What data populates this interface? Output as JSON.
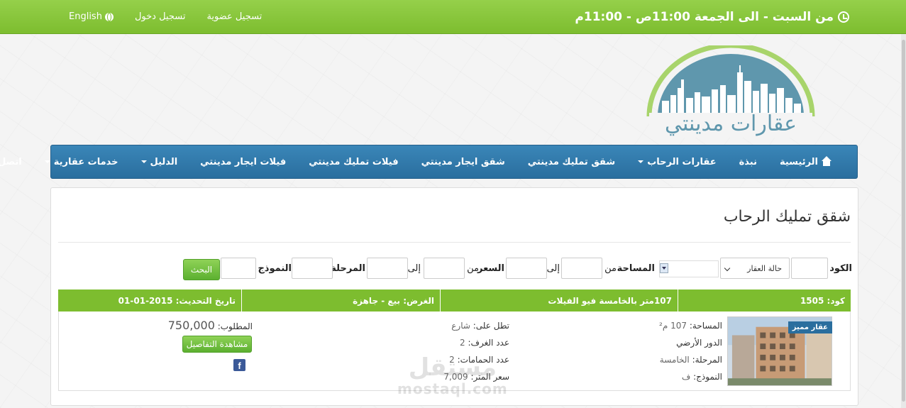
{
  "topbar": {
    "hours": "من السبت - الى الجمعة 11:00ص - 11:00م",
    "register": "تسجيل عضوية",
    "login": "تسجيل دخول",
    "language": "English"
  },
  "logo": {
    "text": "عقارات مدينتي"
  },
  "nav": {
    "items": [
      {
        "label": "الرئيسية",
        "icon": "home-icon"
      },
      {
        "label": "نبذة"
      },
      {
        "label": "عقارات الرحاب",
        "dropdown": true
      },
      {
        "label": "شقق تمليك مدينتي"
      },
      {
        "label": "شقق ايجار مدينتي"
      },
      {
        "label": "فيلات تمليك مدينتي"
      },
      {
        "label": "فيلات ايجار مدينتي"
      },
      {
        "label": "الدليل",
        "dropdown": true
      },
      {
        "label": "خدمات عقارية",
        "dropdown": true
      },
      {
        "label": "اتصل بنا",
        "dropdown": true
      }
    ]
  },
  "page": {
    "title": "شقق تمليك الرحاب"
  },
  "search": {
    "code_label": "الكود",
    "status_select": "حالة العقار",
    "area_label": "المساحة",
    "from": "من",
    "to": "إلى",
    "price_label": "السعر",
    "stage_label": "المرحلة",
    "model_label": "النموذج",
    "submit": "البحث"
  },
  "listing": {
    "code": "كود: 1505",
    "title": "107متر بالخامسة فيو الفيلات",
    "purpose": "الغرض: بيع - جاهزة",
    "updated": "تاريخ التحديث: 2015-01-01",
    "badge": "عقار مميز",
    "area_k": "المساحة:",
    "area_v": "107 م²",
    "floor": "الدور الأرضي",
    "stage_k": "المرحلة:",
    "stage_v": "الخامسة",
    "model_k": "النموذج:",
    "model_v": "ف",
    "view_k": "تطل على:",
    "view_v": "شارع",
    "rooms_k": "عدد الغرف:",
    "rooms_v": "2",
    "baths_k": "عدد الحمامات:",
    "baths_v": "2",
    "meter_k": "سعر المتر:",
    "meter_v": "7,009",
    "price_k": "المطلوب:",
    "price_v": "750,000",
    "details_button": "مشاهدة التفاصيل",
    "facebook": "f"
  },
  "watermark": {
    "arabic": "مستقل",
    "latin": "mostaql.com"
  }
}
